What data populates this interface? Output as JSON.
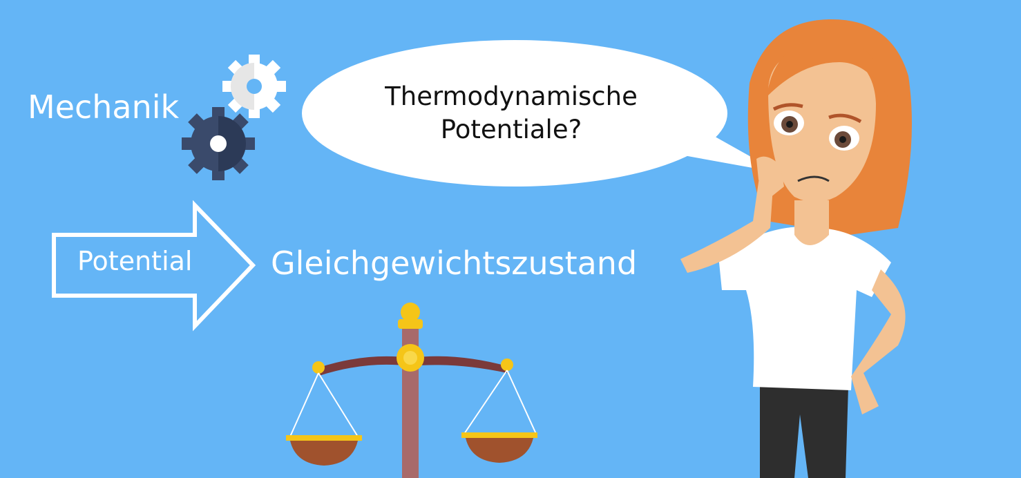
{
  "labels": {
    "mechanics": "Mechanik",
    "potential": "Potential",
    "equilibrium": "Gleichgewichtszustand"
  },
  "speech_bubble": {
    "line1": "Thermodynamische",
    "line2": "Potentiale?"
  },
  "colors": {
    "background": "#64b5f6",
    "gear_light": "#ffffff",
    "gear_dark": "#3a4a6b",
    "hair": "#e8843a",
    "skin": "#f3c293",
    "shirt": "#ffffff",
    "pants": "#2e2e2e",
    "scale_pole": "#a86a6a",
    "scale_gold": "#f5c518",
    "scale_pan": "#a0522d"
  },
  "icons": [
    "gear-icon",
    "arrow-right-icon",
    "balance-scale-icon",
    "woman-character"
  ]
}
